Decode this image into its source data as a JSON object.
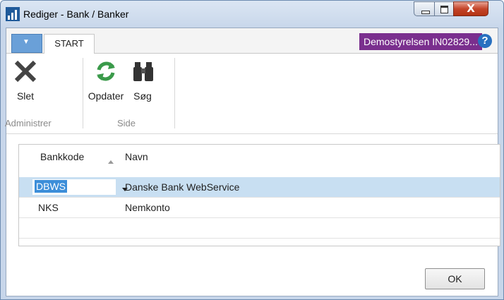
{
  "window": {
    "title": "Rediger - Bank / Banker"
  },
  "tabs": {
    "app_menu": "▼",
    "start": "START"
  },
  "company": "Demostyrelsen IN02829...",
  "help": "?",
  "ribbon": {
    "delete": "Slet",
    "refresh": "Opdater",
    "search": "Søg",
    "group_manage": "Administrer",
    "group_page": "Side"
  },
  "grid": {
    "columns": [
      "Bankkode",
      "Navn"
    ],
    "rows": [
      {
        "code": "DBWS",
        "name": "Danske Bank WebService",
        "selected": true
      },
      {
        "code": "NKS",
        "name": "Nemkonto",
        "selected": false
      }
    ]
  },
  "ok_label": "OK",
  "colors": {
    "selection": "#c8dff2",
    "company_badge": "#7a2f8e",
    "accent": "#6aa0d8"
  }
}
